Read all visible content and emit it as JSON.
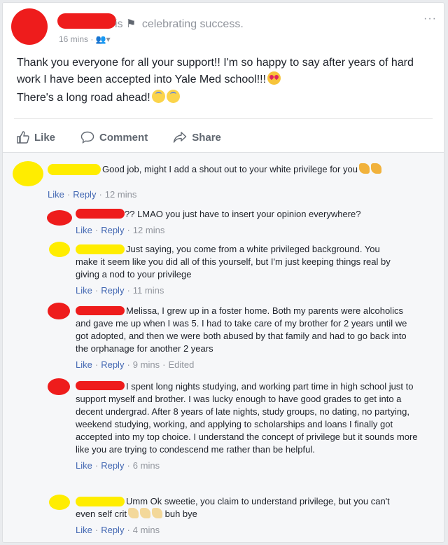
{
  "post": {
    "status_suffix": "is",
    "status_text": "celebrating success.",
    "time": "16 mins",
    "body_line1": "Thank you everyone for all your support!! I'm so happy to say after years of hard work I have been accepted into Yale Med school!!!",
    "body_line2": "There's a long road ahead!",
    "more_label": "···"
  },
  "actions": {
    "like": "Like",
    "comment": "Comment",
    "share": "Share"
  },
  "comments": [
    {
      "text": "Good job, might I add a shout out to your white privilege for you",
      "like": "Like",
      "reply": "Reply",
      "time": "12 mins"
    },
    {
      "text": "?? LMAO you just have to insert your opinion everywhere?",
      "like": "Like",
      "reply": "Reply",
      "time": "12 mins"
    },
    {
      "text": "Just saying, you come from a white privileged background. You make it seem like you did all of this yourself, but I'm just keeping things real by giving a nod to your privilege",
      "like": "Like",
      "reply": "Reply",
      "time": "11 mins"
    },
    {
      "text": "Melissa, I grew up in a foster home. Both my parents were alcoholics and gave me up when I was 5. I had to take care of my brother for 2 years until we got adopted, and then we were both abused by that family and had to go back into the orphanage for another 2 years",
      "like": "Like",
      "reply": "Reply",
      "time": "9 mins",
      "edited": "Edited"
    },
    {
      "text": "I spent long nights studying, and working part time in high school just to support myself and brother. I was lucky enough to have good grades to get into a decent undergrad. After 8 years of late nights, study groups, no dating, no partying, weekend studying, working, and applying to scholarships and loans I finally got accepted into my top choice. I understand the concept of privilege but it sounds more like you are trying to condescend me rather than be helpful.",
      "like": "Like",
      "reply": "Reply",
      "time": "6 mins"
    },
    {
      "text_before": "Umm Ok sweetie, you claim to understand privilege, but you can't even self crit",
      "text_after": "buh bye",
      "like": "Like",
      "reply": "Reply",
      "time": "4 mins"
    }
  ],
  "colors": {
    "redaction_red": "#ee1c1c",
    "redaction_yellow": "#ffed00",
    "link_blue": "#4267b2",
    "meta_gray": "#90949c"
  }
}
